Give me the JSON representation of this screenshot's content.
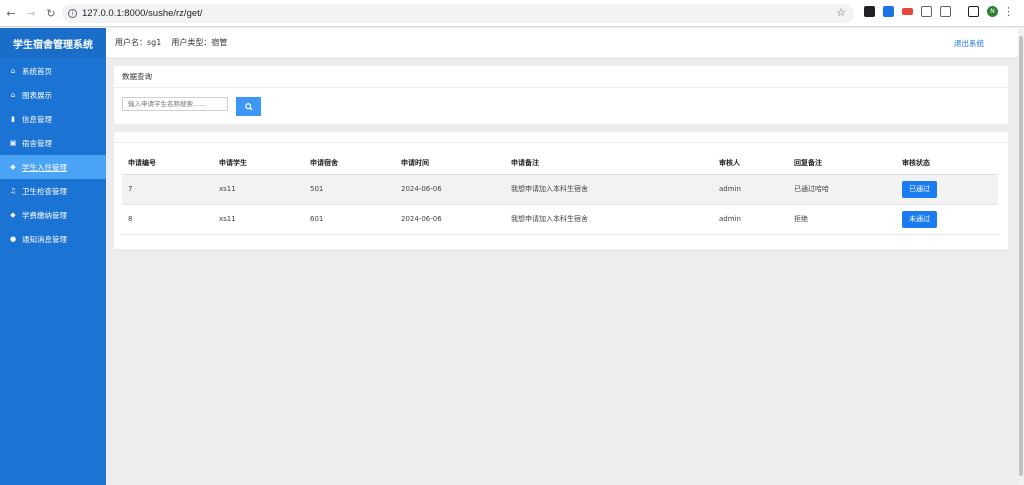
{
  "browser": {
    "url": "127.0.0.1:8000/sushe/rz/get/",
    "profile_initial": "N"
  },
  "sidebar": {
    "brand": "学生宿舍管理系统",
    "items": [
      {
        "label": "系统首页",
        "icon": "home-icon"
      },
      {
        "label": "图表展示",
        "icon": "home-icon"
      },
      {
        "label": "信息管理",
        "icon": "document-icon"
      },
      {
        "label": "宿舍管理",
        "icon": "image-icon"
      },
      {
        "label": "学生入住管理",
        "icon": "diamond-icon",
        "active": true
      },
      {
        "label": "卫生检查管理",
        "icon": "music-icon"
      },
      {
        "label": "学费缴纳管理",
        "icon": "diamond-icon"
      },
      {
        "label": "通知消息管理",
        "icon": "users-icon"
      }
    ]
  },
  "topbar": {
    "user_label": "用户名：sg1",
    "type_label": "用户类型：宿管",
    "logout": "退出系统"
  },
  "query": {
    "title": "数据查询",
    "placeholder": "输入申请学生名称搜索......"
  },
  "table": {
    "headers": [
      "申请编号",
      "申请学生",
      "申请宿舍",
      "申请时间",
      "申请备注",
      "审核人",
      "回复备注",
      "审核状态"
    ],
    "rows": [
      {
        "id": "7",
        "student": "xs11",
        "dorm": "501",
        "date": "2024-06-06",
        "note": "我想申请加入本科生宿舍",
        "reviewer": "admin",
        "reply": "已通过哈哈",
        "status": "已通过"
      },
      {
        "id": "8",
        "student": "xs11",
        "dorm": "601",
        "date": "2024-06-06",
        "note": "我想申请加入本科生宿舍",
        "reviewer": "admin",
        "reply": "拒绝",
        "status": "未通过"
      }
    ]
  },
  "colors": {
    "sidebar": "#1b73d4",
    "sidebar_active": "#4aa3f5",
    "primary_button": "#1a7cf0",
    "link": "#1a73e8"
  }
}
